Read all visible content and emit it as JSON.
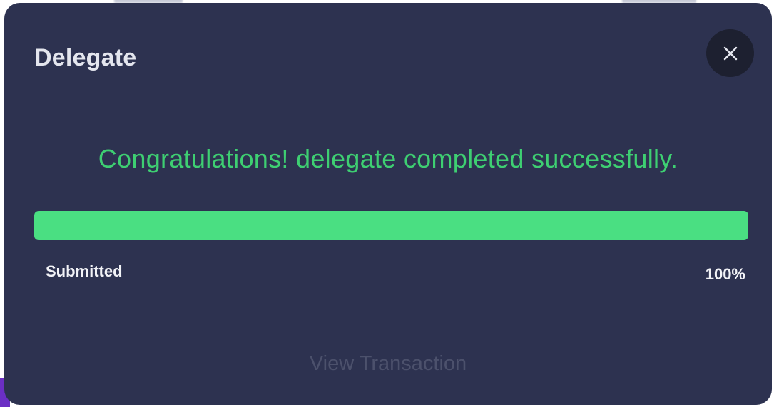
{
  "modal": {
    "title": "Delegate",
    "close_icon": "close-icon",
    "success_message": "Congratulations! delegate completed successfully.",
    "progress": {
      "percent": 100,
      "status_label": "Submitted",
      "percent_label": "100%"
    },
    "view_transaction_label": "View Transaction"
  },
  "colors": {
    "modal_background": "#2d3250",
    "close_button_background": "#1d2030",
    "success_text": "#3ecf72",
    "progress_fill": "#4adf82",
    "muted_link": "#4c516c",
    "accent_purple": "#6b2fc4"
  }
}
